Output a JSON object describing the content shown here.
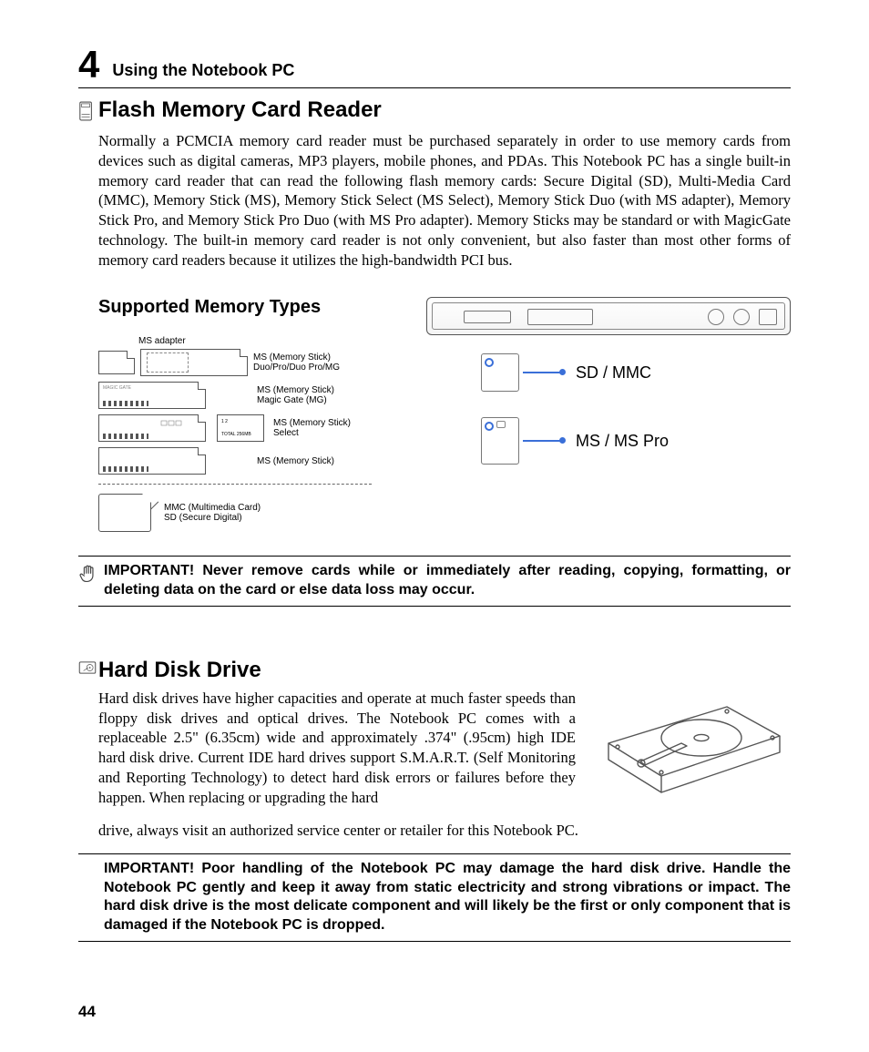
{
  "chapter_num": "4",
  "chapter_title": "Using the Notebook PC",
  "section1": {
    "title": "Flash Memory Card Reader",
    "body": "Normally a PCMCIA memory card reader must be purchased separately in order to use memory cards from devices such as digital cameras, MP3 players, mobile phones, and PDAs. This Notebook PC has a single built-in memory card reader that can read the following flash memory cards: Secure Digital (SD), Multi-Media Card (MMC), Memory Stick (MS), Memory Stick Select (MS Select), Memory Stick Duo (with MS adapter), Memory Stick Pro, and Memory Stick Pro Duo (with MS Pro adapter). Memory Sticks may be standard or with MagicGate technology. The built-in memory card reader is not only convenient, but also faster than most other forms of memory card readers because it utilizes the high-bandwidth PCI bus.",
    "subtitle": "Supported Memory Types",
    "adapter_label": "MS adapter",
    "rows": [
      {
        "label_line1": "MS (Memory Stick)",
        "label_line2": "Duo/Pro/Duo Pro/MG"
      },
      {
        "label_line1": "MS (Memory Stick)",
        "label_line2": "Magic Gate (MG)"
      },
      {
        "label_line1": "MS (Memory Stick)",
        "label_line2": "Select"
      },
      {
        "label_line1": "MS (Memory Stick)",
        "label_line2": ""
      }
    ],
    "bottom_label_line1": "MMC (Multimedia Card)",
    "bottom_label_line2": "SD (Secure Digital)",
    "slot1": "SD / MMC",
    "slot2": "MS / MS Pro",
    "important": "IMPORTANT!  Never remove cards while or immediately after reading, copying, formatting, or deleting data on the card or else data loss may occur."
  },
  "section2": {
    "title": "Hard Disk Drive",
    "body_top": "Hard disk drives have higher capacities and operate at much faster speeds than floppy disk drives and optical drives. The Notebook PC comes with a replaceable 2.5\" (6.35cm) wide and approximately .374\" (.95cm) high IDE hard disk drive. Current IDE hard drives support S.M.A.R.T. (Self Monitoring and Reporting Technology) to detect hard disk errors or failures before they happen. When replacing or upgrading the hard",
    "body_bottom": "drive, always visit an authorized service center or retailer for this Notebook PC.",
    "important": "IMPORTANT!  Poor handling of the Notebook PC may damage the hard disk drive. Handle the Notebook PC gently and keep it away from static electricity and strong vibrations or impact. The hard disk drive is the most delicate component and will likely be the first or only component that is damaged if the Notebook PC is dropped."
  },
  "page_number": "44"
}
